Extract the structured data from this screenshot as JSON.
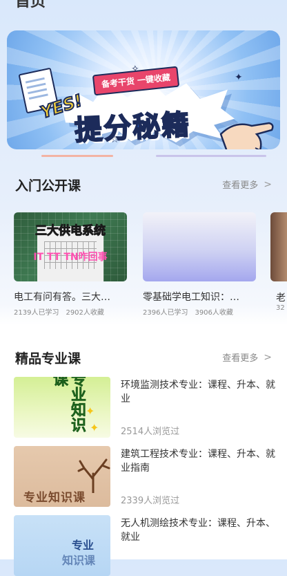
{
  "header": {
    "title": "首页"
  },
  "banner": {
    "ribbon_text": "备考干货 一键收藏",
    "yes_text": "YES!",
    "headline": "提分秘籍"
  },
  "intro_section": {
    "title": "入门公开课",
    "more_label": "查看更多",
    "cards": [
      {
        "thumb_text_top": "三大供电系统",
        "thumb_text_bottom": "IT TT TN咋回事",
        "title": "电工有问有答。三大…",
        "learners": "2139人已学习",
        "favorites": "2902人收藏"
      },
      {
        "title": "零基础学电工知识：…",
        "learners": "2396人已学习",
        "favorites": "3906人收藏"
      },
      {
        "title": "老",
        "learners": "32"
      }
    ]
  },
  "pro_section": {
    "title": "精品专业课",
    "more_label": "查看更多",
    "items": [
      {
        "thumb_text": "专业知识课",
        "title": "环境监测技术专业：课程、升本、就业",
        "views": "2514人浏览过"
      },
      {
        "thumb_text": "专业知识课",
        "title": "建筑工程技术专业：课程、升本、就业指南",
        "views": "2339人浏览过"
      },
      {
        "thumb_text_line1": "专业",
        "thumb_text_line2": "知识课",
        "title": "无人机测绘技术专业：课程、升本、就业"
      }
    ]
  },
  "icons": {
    "chevron": "chevron-right-icon"
  },
  "colors": {
    "accent_pink": "#e8456b",
    "banner_blue": "#1f4ea6",
    "muted_text": "#888888"
  }
}
